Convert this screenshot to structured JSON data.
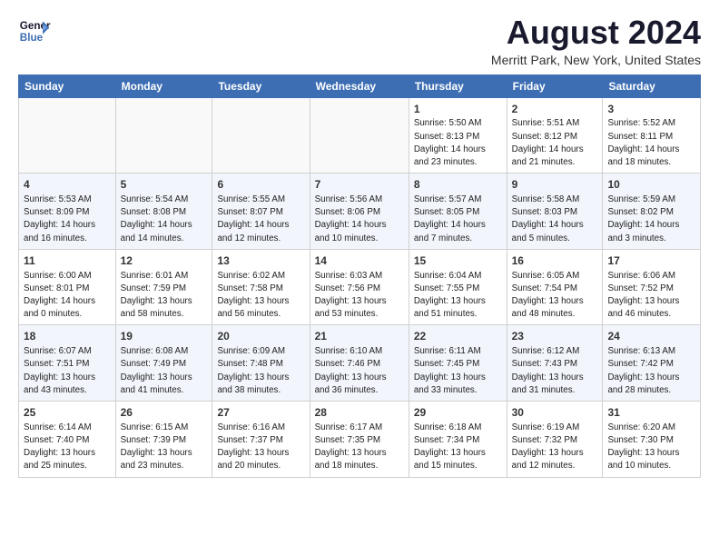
{
  "header": {
    "logo_line1": "General",
    "logo_line2": "Blue",
    "month": "August 2024",
    "location": "Merritt Park, New York, United States"
  },
  "weekdays": [
    "Sunday",
    "Monday",
    "Tuesday",
    "Wednesday",
    "Thursday",
    "Friday",
    "Saturday"
  ],
  "weeks": [
    [
      {
        "day": "",
        "info": ""
      },
      {
        "day": "",
        "info": ""
      },
      {
        "day": "",
        "info": ""
      },
      {
        "day": "",
        "info": ""
      },
      {
        "day": "1",
        "info": "Sunrise: 5:50 AM\nSunset: 8:13 PM\nDaylight: 14 hours\nand 23 minutes."
      },
      {
        "day": "2",
        "info": "Sunrise: 5:51 AM\nSunset: 8:12 PM\nDaylight: 14 hours\nand 21 minutes."
      },
      {
        "day": "3",
        "info": "Sunrise: 5:52 AM\nSunset: 8:11 PM\nDaylight: 14 hours\nand 18 minutes."
      }
    ],
    [
      {
        "day": "4",
        "info": "Sunrise: 5:53 AM\nSunset: 8:09 PM\nDaylight: 14 hours\nand 16 minutes."
      },
      {
        "day": "5",
        "info": "Sunrise: 5:54 AM\nSunset: 8:08 PM\nDaylight: 14 hours\nand 14 minutes."
      },
      {
        "day": "6",
        "info": "Sunrise: 5:55 AM\nSunset: 8:07 PM\nDaylight: 14 hours\nand 12 minutes."
      },
      {
        "day": "7",
        "info": "Sunrise: 5:56 AM\nSunset: 8:06 PM\nDaylight: 14 hours\nand 10 minutes."
      },
      {
        "day": "8",
        "info": "Sunrise: 5:57 AM\nSunset: 8:05 PM\nDaylight: 14 hours\nand 7 minutes."
      },
      {
        "day": "9",
        "info": "Sunrise: 5:58 AM\nSunset: 8:03 PM\nDaylight: 14 hours\nand 5 minutes."
      },
      {
        "day": "10",
        "info": "Sunrise: 5:59 AM\nSunset: 8:02 PM\nDaylight: 14 hours\nand 3 minutes."
      }
    ],
    [
      {
        "day": "11",
        "info": "Sunrise: 6:00 AM\nSunset: 8:01 PM\nDaylight: 14 hours\nand 0 minutes."
      },
      {
        "day": "12",
        "info": "Sunrise: 6:01 AM\nSunset: 7:59 PM\nDaylight: 13 hours\nand 58 minutes."
      },
      {
        "day": "13",
        "info": "Sunrise: 6:02 AM\nSunset: 7:58 PM\nDaylight: 13 hours\nand 56 minutes."
      },
      {
        "day": "14",
        "info": "Sunrise: 6:03 AM\nSunset: 7:56 PM\nDaylight: 13 hours\nand 53 minutes."
      },
      {
        "day": "15",
        "info": "Sunrise: 6:04 AM\nSunset: 7:55 PM\nDaylight: 13 hours\nand 51 minutes."
      },
      {
        "day": "16",
        "info": "Sunrise: 6:05 AM\nSunset: 7:54 PM\nDaylight: 13 hours\nand 48 minutes."
      },
      {
        "day": "17",
        "info": "Sunrise: 6:06 AM\nSunset: 7:52 PM\nDaylight: 13 hours\nand 46 minutes."
      }
    ],
    [
      {
        "day": "18",
        "info": "Sunrise: 6:07 AM\nSunset: 7:51 PM\nDaylight: 13 hours\nand 43 minutes."
      },
      {
        "day": "19",
        "info": "Sunrise: 6:08 AM\nSunset: 7:49 PM\nDaylight: 13 hours\nand 41 minutes."
      },
      {
        "day": "20",
        "info": "Sunrise: 6:09 AM\nSunset: 7:48 PM\nDaylight: 13 hours\nand 38 minutes."
      },
      {
        "day": "21",
        "info": "Sunrise: 6:10 AM\nSunset: 7:46 PM\nDaylight: 13 hours\nand 36 minutes."
      },
      {
        "day": "22",
        "info": "Sunrise: 6:11 AM\nSunset: 7:45 PM\nDaylight: 13 hours\nand 33 minutes."
      },
      {
        "day": "23",
        "info": "Sunrise: 6:12 AM\nSunset: 7:43 PM\nDaylight: 13 hours\nand 31 minutes."
      },
      {
        "day": "24",
        "info": "Sunrise: 6:13 AM\nSunset: 7:42 PM\nDaylight: 13 hours\nand 28 minutes."
      }
    ],
    [
      {
        "day": "25",
        "info": "Sunrise: 6:14 AM\nSunset: 7:40 PM\nDaylight: 13 hours\nand 25 minutes."
      },
      {
        "day": "26",
        "info": "Sunrise: 6:15 AM\nSunset: 7:39 PM\nDaylight: 13 hours\nand 23 minutes."
      },
      {
        "day": "27",
        "info": "Sunrise: 6:16 AM\nSunset: 7:37 PM\nDaylight: 13 hours\nand 20 minutes."
      },
      {
        "day": "28",
        "info": "Sunrise: 6:17 AM\nSunset: 7:35 PM\nDaylight: 13 hours\nand 18 minutes."
      },
      {
        "day": "29",
        "info": "Sunrise: 6:18 AM\nSunset: 7:34 PM\nDaylight: 13 hours\nand 15 minutes."
      },
      {
        "day": "30",
        "info": "Sunrise: 6:19 AM\nSunset: 7:32 PM\nDaylight: 13 hours\nand 12 minutes."
      },
      {
        "day": "31",
        "info": "Sunrise: 6:20 AM\nSunset: 7:30 PM\nDaylight: 13 hours\nand 10 minutes."
      }
    ]
  ]
}
